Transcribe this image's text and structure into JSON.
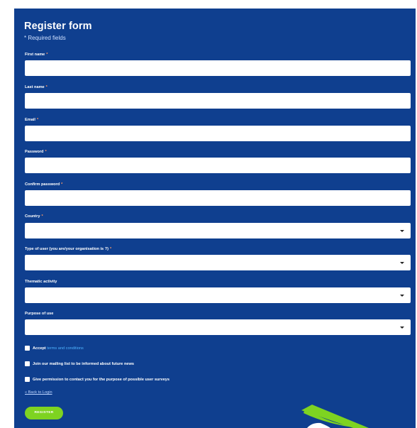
{
  "form": {
    "title": "Register form",
    "required_note": "* Required fields",
    "fields": [
      {
        "label": "First name",
        "required": "*",
        "value": ""
      },
      {
        "label": "Last name",
        "required": "*",
        "value": ""
      },
      {
        "label": "Email",
        "required": "*",
        "value": ""
      },
      {
        "label": "Password",
        "required": "*",
        "value": ""
      },
      {
        "label": "Confirm password",
        "required": "*",
        "value": ""
      }
    ],
    "selects": [
      {
        "label": "Country",
        "required": "*",
        "value": ""
      },
      {
        "label": "Type of user (you are/your organisation is ?)",
        "required": "*",
        "value": ""
      },
      {
        "label": "Thematic activity",
        "required": "",
        "value": ""
      },
      {
        "label": "Purpose of use",
        "required": "",
        "value": ""
      }
    ],
    "checkboxes": {
      "accept_prefix": "Accept",
      "accept_link": "terms and conditions",
      "mailing": "Join our mailing list to be informed about future news",
      "permission": "Give permission to contact you for the purpose of possible user surveys"
    },
    "back_link": "« Back to Login",
    "register_button": "REGISTER"
  },
  "colors": {
    "panel_bg": "#0f3f8f",
    "accent_green": "#7ed321",
    "link_blue": "#4fb4ff",
    "required_star": "#ff9a66"
  },
  "icons": [
    "chevron-down-icon",
    "checkbox-icon"
  ]
}
